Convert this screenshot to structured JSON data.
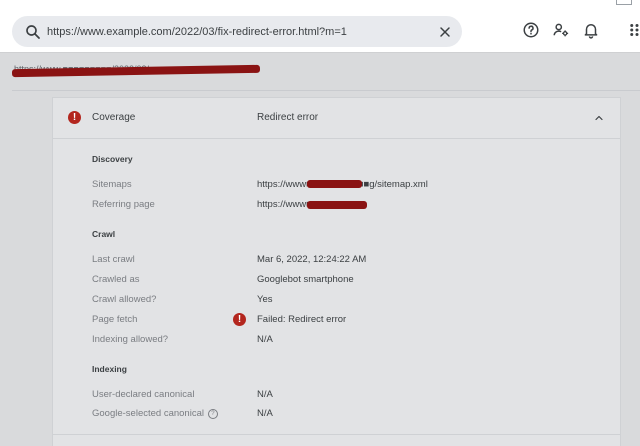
{
  "search": {
    "url": "https://www.example.com/2022/03/fix-redirect-error.html?m=1",
    "search_icon": "search-icon",
    "clear_icon": "close-icon"
  },
  "top_icons": [
    "help-icon",
    "account-settings-icon",
    "bell-icon",
    "apps-grid-icon"
  ],
  "breadcrumb": {
    "text": "https://www.■■■■■■■■■/2022/03/■■■■■■■■■■"
  },
  "coverage": {
    "label": "Coverage",
    "status": "Redirect error",
    "status_icon": "error-icon",
    "expand_icon": "chevron-up-icon"
  },
  "sections": {
    "discovery": {
      "title": "Discovery",
      "sitemaps_label": "Sitemaps",
      "sitemaps_value": "https://www■■■■■■■■■■■g/sitemap.xml",
      "referring_label": "Referring page",
      "referring_value": "https://www■■■■■■■■■■"
    },
    "crawl": {
      "title": "Crawl",
      "last_crawl_label": "Last crawl",
      "last_crawl_value": "Mar 6, 2022, 12:24:22 AM",
      "crawled_as_label": "Crawled as",
      "crawled_as_value": "Googlebot smartphone",
      "crawl_allowed_label": "Crawl allowed?",
      "crawl_allowed_value": "Yes",
      "page_fetch_label": "Page fetch",
      "page_fetch_value": "Failed: Redirect error",
      "indexing_allowed_label": "Indexing allowed?",
      "indexing_allowed_value": "N/A"
    },
    "indexing": {
      "title": "Indexing",
      "user_canonical_label": "User-declared canonical",
      "user_canonical_value": "N/A",
      "google_canonical_label": "Google-selected canonical",
      "google_canonical_value": "N/A"
    }
  },
  "colors": {
    "error": "#b3261e",
    "redaction": "#8a1313",
    "background": "#d9dadc",
    "panel": "#e2e3e5"
  }
}
